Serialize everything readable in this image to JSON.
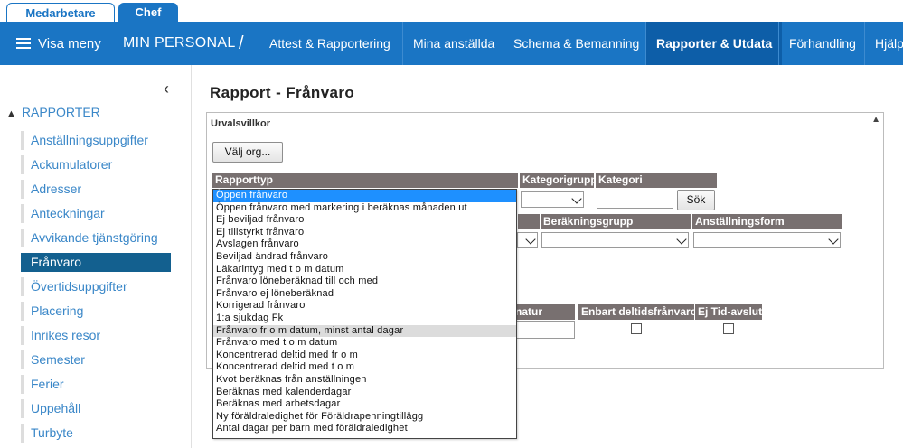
{
  "role_tabs": {
    "medarbetare": "Medarbetare",
    "chef": "Chef"
  },
  "nav": {
    "menu_label": "Visa meny",
    "section_title": "MIN PERSONAL",
    "separator": "/",
    "items": [
      "Attest & Rapportering",
      "Mina anställda",
      "Schema & Bemanning",
      "Rapporter & Utdata",
      "Förhandling",
      "Hjälp"
    ],
    "active_item": "Rapporter & Utdata"
  },
  "sidebar": {
    "collapse_glyph": "‹",
    "section_label": "RAPPORTER",
    "items": [
      "Anställningsuppgifter",
      "Ackumulatorer",
      "Adresser",
      "Anteckningar",
      "Avvikande tjänstgöring",
      "Frånvaro",
      "Övertidsuppgifter",
      "Placering",
      "Inrikes resor",
      "Semester",
      "Ferier",
      "Uppehåll",
      "Turbyte"
    ],
    "active_item": "Frånvaro"
  },
  "page": {
    "title": "Rapport - Frånvaro"
  },
  "filters": {
    "panel_title": "Urvalsvillkor",
    "choose_org_button": "Välj org...",
    "search_button": "Sök",
    "headers": {
      "rapporttyp": "Rapporttyp",
      "kategorigrupp": "Kategorigrupp",
      "kategori": "Kategori",
      "berakningsgrupp": "Beräkningsgrupp",
      "anstallningsform": "Anställningsform",
      "signatur_partial": "natur",
      "enbart_deltid": "Enbart deltidsfrånvaro",
      "ej_tid_avslut": "Ej Tid-avslut"
    }
  },
  "rapporttyp_dropdown": {
    "selected": "Öppen frånvaro",
    "hovered": "Frånvaro fr o m datum, minst antal dagar",
    "options": [
      "Öppen frånvaro",
      "Öppen frånvaro med markering i beräknas månaden ut",
      "Ej beviljad frånvaro",
      "Ej tillstyrkt frånvaro",
      "Avslagen frånvaro",
      "Beviljad ändrad frånvaro",
      "Läkarintyg med t o m datum",
      "Frånvaro löneberäknad till och med",
      "Frånvaro ej löneberäknad",
      "Korrigerad frånvaro",
      "1:a sjukdag Fk",
      "Frånvaro fr o m datum, minst antal dagar",
      "Frånvaro med t o m datum",
      "Koncentrerad deltid med fr o m",
      "Koncentrerad deltid med t o m",
      "Kvot beräknas från anställningen",
      "Beräknas med kalenderdagar",
      "Beräknas med arbetsdagar",
      "Ny föräldraledighet för Föräldrapenningtillägg",
      "Antal dagar per barn med föräldraledighet"
    ]
  }
}
